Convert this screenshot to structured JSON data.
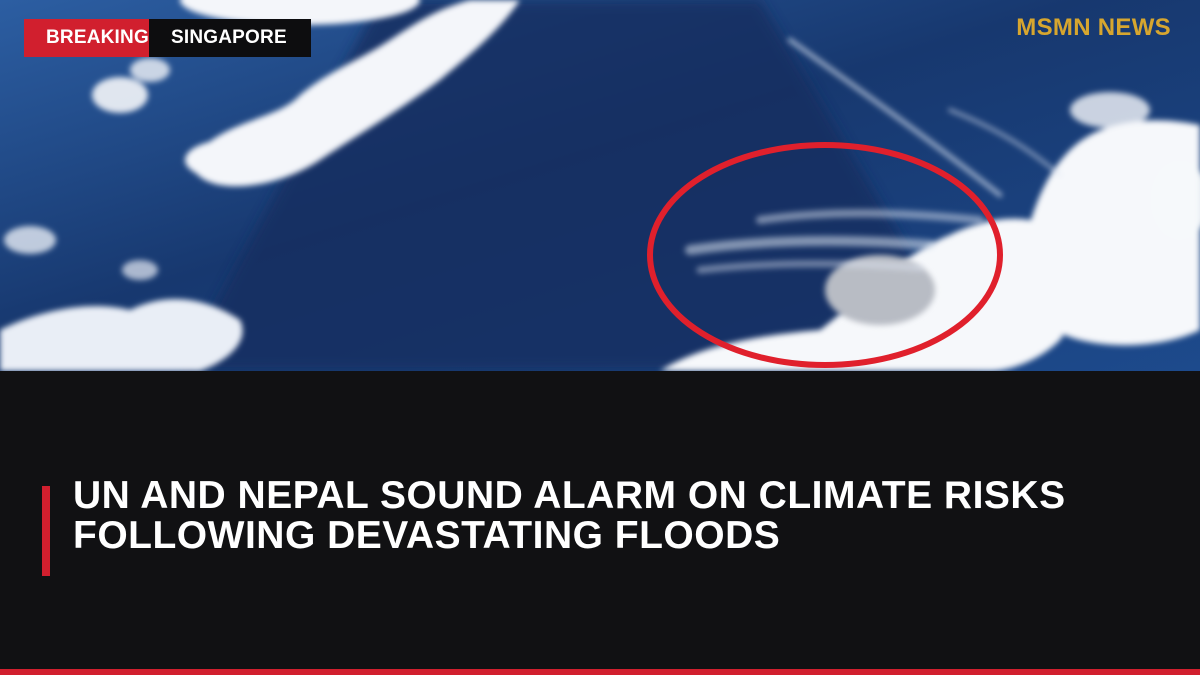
{
  "photo": {
    "icon": "sky-clouds-photo",
    "highlight_color": "#e0202c"
  },
  "badges": {
    "breaking": "BREAKING",
    "location": "SINGAPORE"
  },
  "brand": {
    "name": "MSMN NEWS",
    "color": "#d7a62f"
  },
  "headline": {
    "text": "UN AND NEPAL SOUND ALARM ON CLIMATE RISKS FOLLOWING DEVASTATING FLOODS"
  },
  "colors": {
    "accent": "#d11f2e",
    "panel": "#111113"
  }
}
